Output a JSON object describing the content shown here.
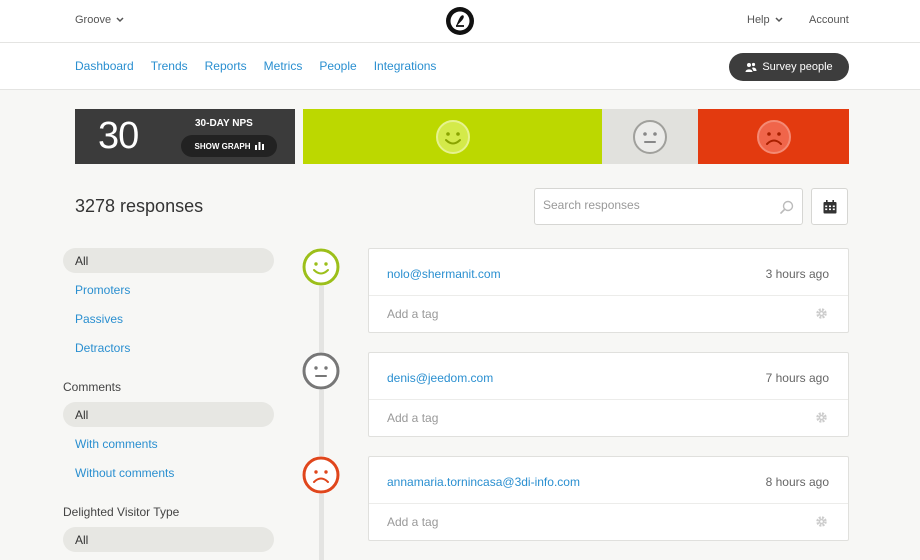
{
  "topbar": {
    "workspace": "Groove",
    "help": "Help",
    "account": "Account"
  },
  "nav": {
    "links": [
      "Dashboard",
      "Trends",
      "Reports",
      "Metrics",
      "People",
      "Integrations"
    ],
    "survey_button": "Survey people"
  },
  "nps": {
    "score": "30",
    "label": "30-DAY NPS",
    "show_graph": "SHOW GRAPH",
    "segments": [
      {
        "name": "promoters",
        "color": "#bcd800",
        "icon": "smile-face-icon"
      },
      {
        "name": "passives",
        "color": "#e1e1dd",
        "icon": "neutral-face-icon"
      },
      {
        "name": "detractors",
        "color": "#e33a0f",
        "icon": "sad-face-icon"
      }
    ]
  },
  "responses": {
    "title": "3278 responses",
    "search_placeholder": "Search responses"
  },
  "sidebar": {
    "type_filters": [
      "All",
      "Promoters",
      "Passives",
      "Detractors"
    ],
    "comments_heading": "Comments",
    "comment_filters": [
      "All",
      "With comments",
      "Without comments"
    ],
    "visitor_heading": "Delighted Visitor Type",
    "visitor_filters": [
      "All"
    ]
  },
  "feed": [
    {
      "email": "nolo@shermanit.com",
      "time": "3 hours ago",
      "tag_placeholder": "Add a tag",
      "sentiment": "promoter",
      "color": "#9cbf1a"
    },
    {
      "email": "denis@jeedom.com",
      "time": "7 hours ago",
      "tag_placeholder": "Add a tag",
      "sentiment": "passive",
      "color": "#777777"
    },
    {
      "email": "annamaria.tornincasa@3di-info.com",
      "time": "8 hours ago",
      "tag_placeholder": "Add a tag",
      "sentiment": "detractor",
      "color": "#e0461c"
    }
  ]
}
